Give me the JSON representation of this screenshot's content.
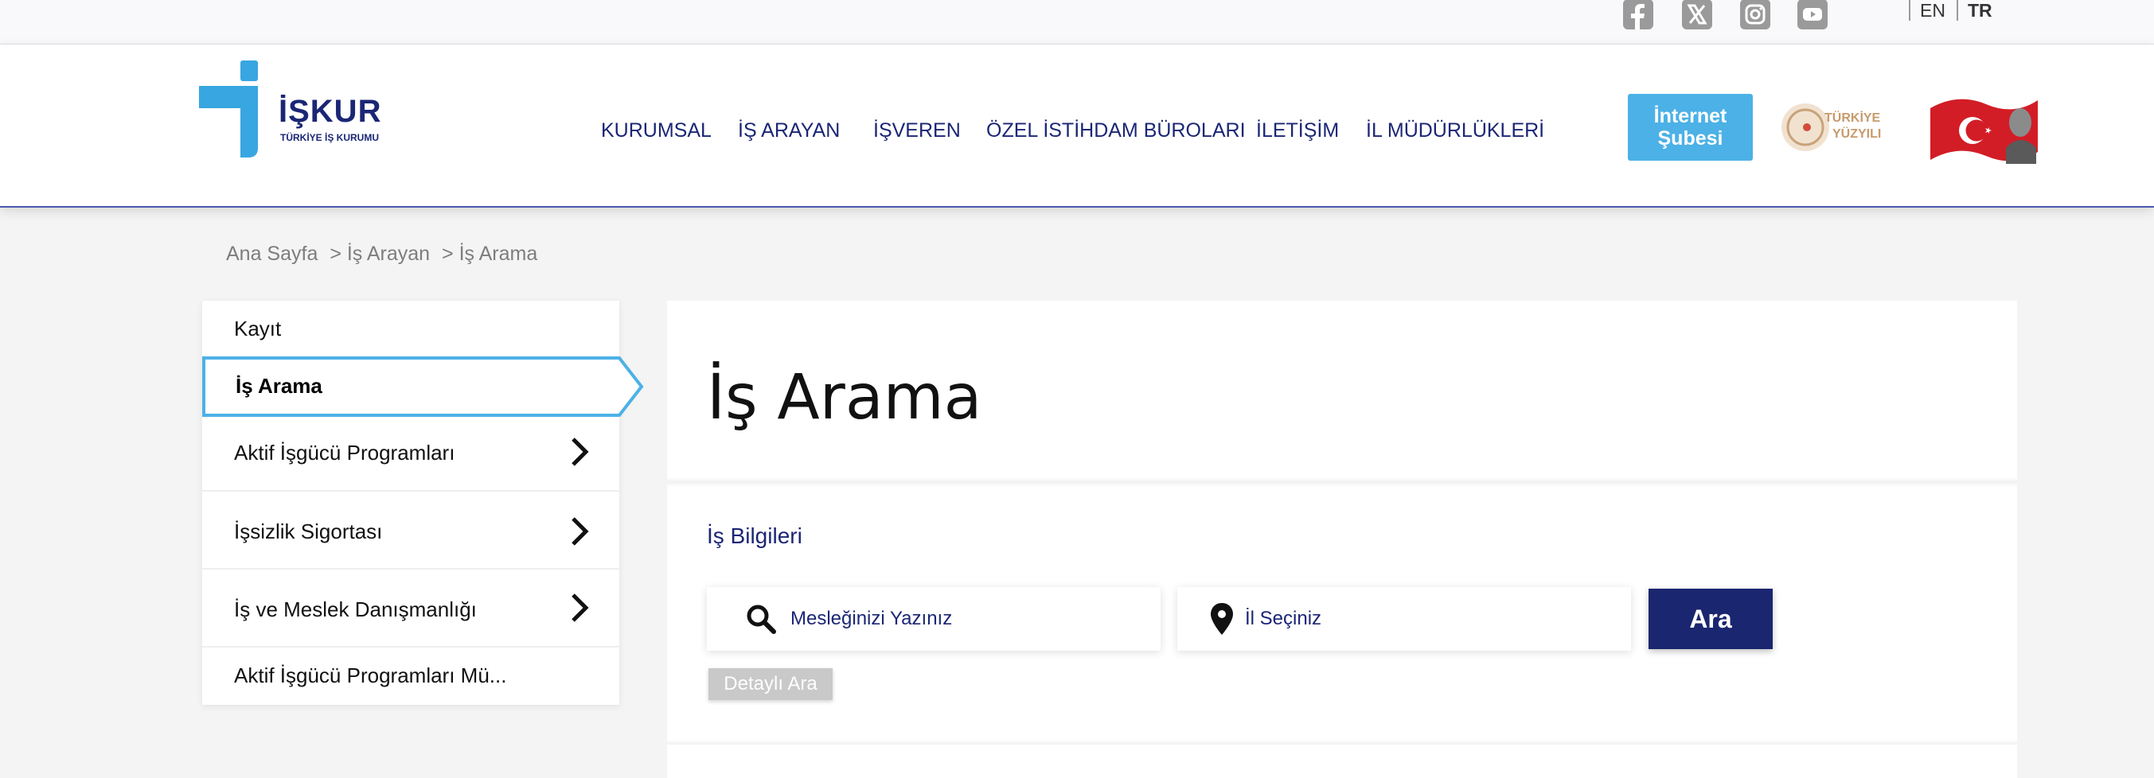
{
  "topbar": {
    "social": [
      "facebook-icon",
      "x-icon",
      "instagram-icon",
      "youtube-icon"
    ],
    "lang_en": "EN",
    "lang_tr": "TR"
  },
  "header": {
    "logo_text": "İŞKUR",
    "logo_subtitle": "TÜRKİYE İŞ KURUMU",
    "nav": [
      "KURUMSAL",
      "İŞ ARAYAN",
      "İŞVEREN",
      "ÖZEL İSTİHDAM BÜROLARI",
      "İLETİŞİM",
      "İL MÜDÜRLÜKLERİ"
    ],
    "internet_line1": "İnternet",
    "internet_line2": "Şubesi",
    "ty_line1": "TÜRKİYE",
    "ty_line2": "YÜZYILI"
  },
  "breadcrumb": [
    "Ana Sayfa",
    "> İş Arayan",
    "> İş Arama"
  ],
  "sidebar": {
    "items": [
      {
        "label": "Kayıt"
      },
      {
        "label": "İş Arama"
      },
      {
        "label": "Aktif İşgücü Programları"
      },
      {
        "label": "İşsizlik Sigortası"
      },
      {
        "label": "İş ve Meslek Danışmanlığı"
      },
      {
        "label": "Aktif İşgücü Programları Mü..."
      }
    ]
  },
  "main": {
    "title": "İş Arama",
    "section_title": "İş Bilgileri",
    "job_placeholder": "Mesleğinizi Yazınız",
    "city_placeholder": "İl Seçiniz",
    "search_button": "Ara",
    "advanced_button": "Detaylı Ara"
  },
  "colors": {
    "navy": "#1b2675",
    "accent_blue": "#4cb1e6",
    "logo_cyan": "#38a6e0"
  }
}
